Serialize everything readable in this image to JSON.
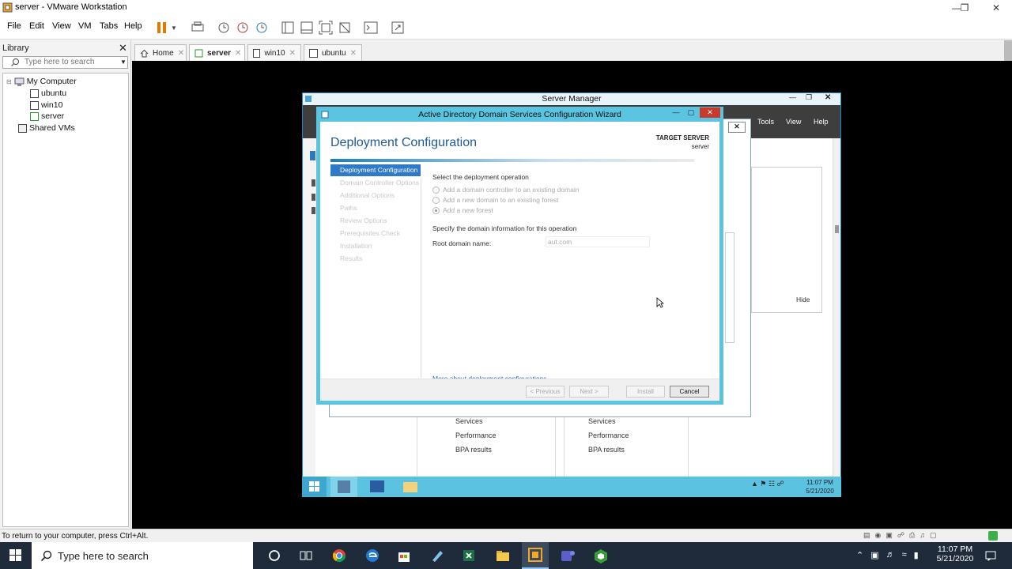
{
  "window": {
    "title": "server - VMware Workstation"
  },
  "menubar": {
    "items": [
      "File",
      "Edit",
      "View",
      "VM",
      "Tabs",
      "Help"
    ]
  },
  "library": {
    "title": "Library",
    "search_placeholder": "Type here to search",
    "tree": {
      "root": "My Computer",
      "vms": [
        "ubuntu",
        "win10",
        "server"
      ],
      "shared": "Shared VMs"
    }
  },
  "tabs": [
    {
      "label": "Home"
    },
    {
      "label": "server"
    },
    {
      "label": "win10"
    },
    {
      "label": "ubuntu"
    }
  ],
  "server_manager": {
    "title": "Server Manager",
    "menus": [
      "Tools",
      "View",
      "Help"
    ],
    "hide_label": "Hide",
    "tiles_left": [
      "Services",
      "Performance",
      "BPA results"
    ],
    "tiles_right": [
      "Services",
      "Performance",
      "BPA results"
    ],
    "guest_clock": {
      "time": "11:07 PM",
      "date": "5/21/2020"
    }
  },
  "wizard": {
    "title": "Active Directory Domain Services Configuration Wizard",
    "heading": "Deployment Configuration",
    "target_label": "TARGET SERVER",
    "target_value": "server",
    "nav": [
      "Deployment Configuration",
      "Domain Controller Options",
      "Additional Options",
      "Paths",
      "Review Options",
      "Prerequisites Check",
      "Installation",
      "Results"
    ],
    "select_label": "Select the deployment operation",
    "options": [
      "Add a domain controller to an existing domain",
      "Add a new domain to an existing forest",
      "Add a new forest"
    ],
    "selected_option": "Add a new forest",
    "specify_label": "Specify the domain information for this operation",
    "root_label": "Root domain name:",
    "root_value": "aut.com",
    "more_link": "More about deployment configurations",
    "buttons": {
      "previous": "< Previous",
      "next": "Next >",
      "install": "Install",
      "cancel": "Cancel"
    }
  },
  "statusbar": {
    "text": "To return to your computer, press Ctrl+Alt."
  },
  "host_taskbar": {
    "search_placeholder": "Type here to search",
    "time": "11:07 PM",
    "date": "5/21/2020"
  }
}
